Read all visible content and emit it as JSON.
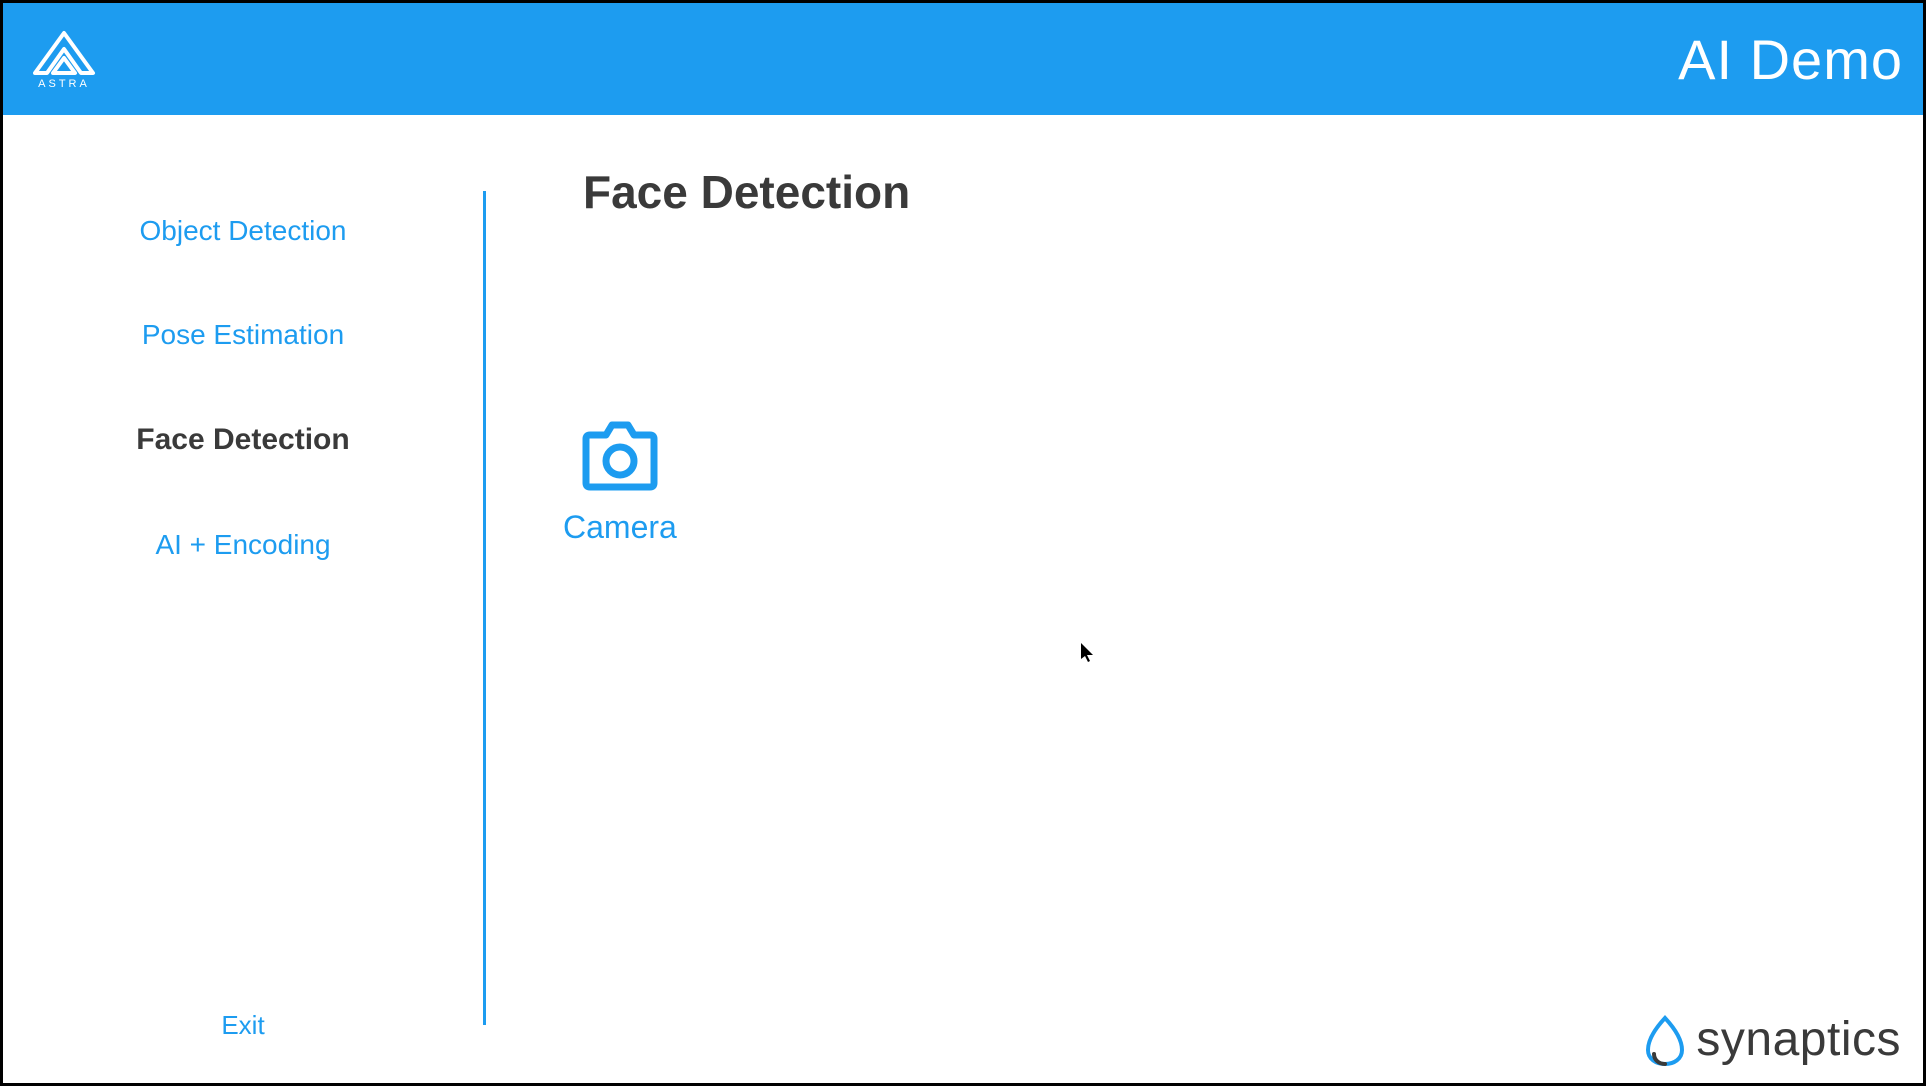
{
  "header": {
    "brand": "ASTRA",
    "title": "AI Demo"
  },
  "sidebar": {
    "items": [
      {
        "label": "Object Detection",
        "selected": false
      },
      {
        "label": "Pose Estimation",
        "selected": false
      },
      {
        "label": "Face Detection",
        "selected": true
      },
      {
        "label": "AI + Encoding",
        "selected": false
      }
    ],
    "exit_label": "Exit"
  },
  "main": {
    "title": "Face Detection",
    "camera_label": "Camera"
  },
  "footer": {
    "brand": "synaptics"
  },
  "colors": {
    "accent": "#1d9cf0",
    "text_dark": "#3a3a3a"
  }
}
